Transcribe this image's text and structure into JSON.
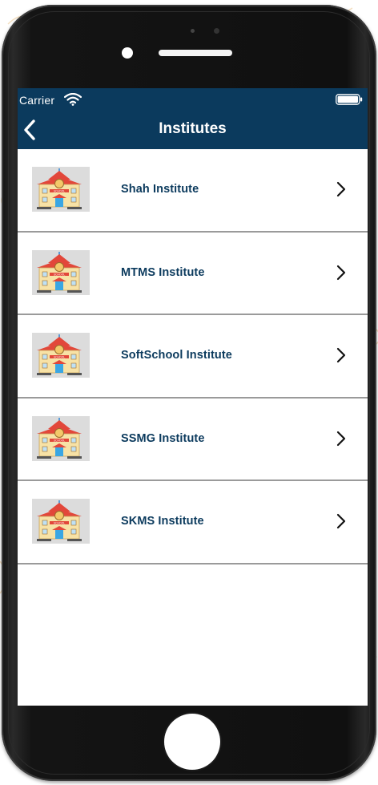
{
  "status_bar": {
    "carrier": "Carrier"
  },
  "nav": {
    "title": "Institutes"
  },
  "institutes": [
    {
      "name": "Shah Institute"
    },
    {
      "name": "MTMS Institute"
    },
    {
      "name": "SoftSchool Institute"
    },
    {
      "name": "SSMG Institute"
    },
    {
      "name": "SKMS Institute"
    }
  ],
  "icons": {
    "back": "chevron-left-icon",
    "row_arrow": "chevron-right-icon",
    "row_image": "school-building-icon",
    "wifi": "wifi-icon",
    "battery": "battery-icon"
  },
  "colors": {
    "nav_bg": "#0b3a5d",
    "label": "#0b3a5d",
    "divider": "#9a9a9a"
  }
}
